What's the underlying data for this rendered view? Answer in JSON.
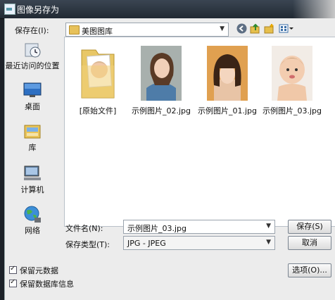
{
  "window": {
    "title": "图像另存为"
  },
  "toolbar": {
    "save_in_label": "保存在(I):",
    "save_in_value": "美图图库"
  },
  "places": [
    {
      "label": "最近访问的位置",
      "icon": "recent-places-icon"
    },
    {
      "label": "桌面",
      "icon": "desktop-icon"
    },
    {
      "label": "库",
      "icon": "library-icon"
    },
    {
      "label": "计算机",
      "icon": "computer-icon"
    },
    {
      "label": "网络",
      "icon": "network-icon"
    }
  ],
  "files": [
    {
      "name": "[原始文件]",
      "kind": "folder"
    },
    {
      "name": "示例图片_02.jpg",
      "kind": "image"
    },
    {
      "name": "示例图片_01.jpg",
      "kind": "image"
    },
    {
      "name": "示例图片_03.jpg",
      "kind": "image"
    }
  ],
  "form": {
    "filename_label": "文件名(N):",
    "filename_value": "示例图片_03.jpg",
    "filetype_label": "保存类型(T):",
    "filetype_value": "JPG - JPEG",
    "save_button": "保存(S)",
    "cancel_button": "取消",
    "options_button": "选项(O)..."
  },
  "checkboxes": [
    {
      "label": "保留元数据",
      "checked": true
    },
    {
      "label": "保留数据库信息",
      "checked": true
    }
  ]
}
